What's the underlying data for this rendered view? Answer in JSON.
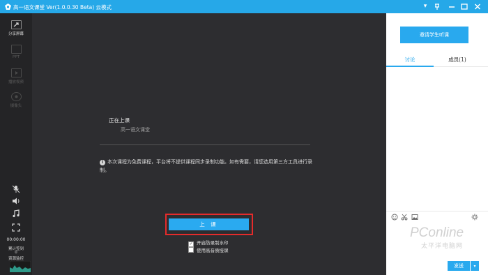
{
  "window": {
    "title": "高一语文课堂 Ver(1.0.0.30 Beta)  云模式",
    "controls": [
      "menu-dropdown",
      "pin",
      "minimize",
      "maximize",
      "close"
    ]
  },
  "sidebar": {
    "share_screen": "分享屏幕",
    "dim_items": [
      "PPT",
      "播放视频",
      "摄像头"
    ],
    "clock": "00:00:00",
    "stats_label": "累计签到",
    "stats_value": "0",
    "resource_label": "资源监控"
  },
  "main": {
    "status_title": "正在上课",
    "status_sub": "高一语文课堂",
    "notice_text": "本次课程为免费课程，平台将不提供课程同步录制功能。如有需要，请您选用第三方工具进行录制。",
    "start_button": "上 课",
    "option_watermark": "开启防录制水印",
    "option_hq": "使用高音质授课",
    "option_watermark_checked": true,
    "option_hq_checked": false
  },
  "right_panel": {
    "invite_button": "邀请学生听课",
    "tabs": [
      "讨论",
      "成员(1)"
    ],
    "active_tab": 0,
    "send_button": "发送",
    "watermark_text": "PConline",
    "watermark_sub": "太平洋电脑网"
  },
  "colors": {
    "accent": "#29a9ee",
    "titlebar": "#26a8e8",
    "highlight": "#e52b2b"
  }
}
